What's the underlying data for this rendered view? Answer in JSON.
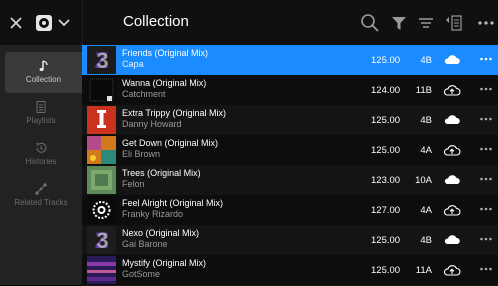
{
  "header": {
    "title": "Collection",
    "icons": [
      "close-icon",
      "rekordbox-logo-icon",
      "chevron-down-icon",
      "search-icon",
      "filter-icon",
      "sort-icon",
      "list-settings-icon",
      "more-icon"
    ]
  },
  "sidebar": {
    "items": [
      {
        "label": "Collection",
        "icon": "music-note-icon",
        "active": true
      },
      {
        "label": "Playlists",
        "icon": "playlist-icon",
        "active": false
      },
      {
        "label": "Histories",
        "icon": "history-icon",
        "active": false
      },
      {
        "label": "Related Tracks",
        "icon": "related-tracks-icon",
        "active": false
      }
    ]
  },
  "tracks": [
    {
      "title": "Friends (Original Mix)",
      "artist": "Capa",
      "bpm": "125.00",
      "key": "4B",
      "cloud": "cloud-synced-icon"
    },
    {
      "title": "Wanna (Original Mix)",
      "artist": "Catchment",
      "bpm": "124.00",
      "key": "11B",
      "cloud": "cloud-upload-icon"
    },
    {
      "title": "Extra Trippy (Original Mix)",
      "artist": "Danny Howard",
      "bpm": "125.00",
      "key": "4B",
      "cloud": "cloud-synced-icon"
    },
    {
      "title": "Get Down (Original Mix)",
      "artist": "Eli Brown",
      "bpm": "125.00",
      "key": "4A",
      "cloud": "cloud-upload-icon"
    },
    {
      "title": "Trees (Original Mix)",
      "artist": "Felon",
      "bpm": "123.00",
      "key": "10A",
      "cloud": "cloud-synced-icon"
    },
    {
      "title": "Feel Alright (Original Mix)",
      "artist": "Franky Rizardo",
      "bpm": "127.00",
      "key": "4A",
      "cloud": "cloud-upload-icon"
    },
    {
      "title": "Nexo (Original Mix)",
      "artist": "Gai Barone",
      "bpm": "125.00",
      "key": "4B",
      "cloud": "cloud-synced-icon"
    },
    {
      "title": "Mystify (Original Mix)",
      "artist": "GotSome",
      "bpm": "125.00",
      "key": "11A",
      "cloud": "cloud-upload-icon"
    }
  ],
  "colors": {
    "accent": "#1a8cff",
    "sidebar": "#222222",
    "active_item": "#3a3a3a"
  }
}
